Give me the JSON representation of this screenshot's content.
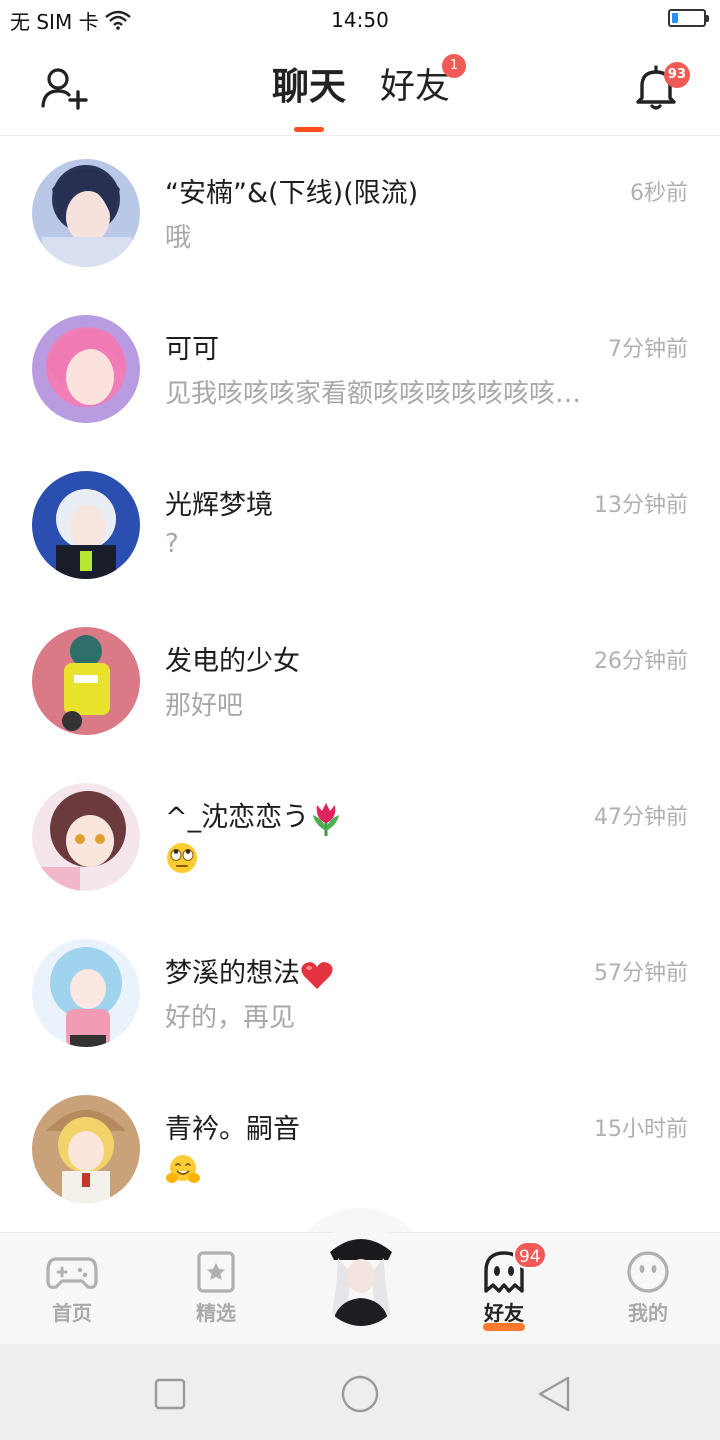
{
  "status_bar": {
    "carrier": "无 SIM 卡",
    "time": "14:50",
    "battery_level": 0.2
  },
  "header": {
    "tabs": [
      {
        "label": "聊天",
        "active": true
      },
      {
        "label": "好友",
        "active": false,
        "badge": "1"
      }
    ],
    "notification_badge": "93",
    "accent_color": "#ff4f1f",
    "badge_color": "#f25a55"
  },
  "chats": [
    {
      "name": "“安楠”&(下线)(限流)",
      "message": "哦",
      "time": "6秒前"
    },
    {
      "name": "可可",
      "message": "见我咳咳咳家看额咳咳咳咳咳咳咳咳咳咳咳",
      "time": "7分钟前"
    },
    {
      "name": "光辉梦境",
      "message": "?",
      "time": "13分钟前"
    },
    {
      "name": "发电的少女",
      "message": "那好吧",
      "time": "26分钟前"
    },
    {
      "name": "^_沈恋恋う",
      "name_emoji": "tulip-emoji",
      "message_emoji": "eye-roll-emoji",
      "message": "",
      "time": "47分钟前"
    },
    {
      "name": "梦溪的想法",
      "name_emoji": "heart-emoji",
      "message": "好的，再见",
      "time": "57分钟前"
    },
    {
      "name": "青衿。嗣音",
      "message_emoji": "hug-emoji",
      "message": "",
      "time": "15小时前"
    }
  ],
  "bottom_nav": {
    "items": [
      {
        "label": "首页",
        "icon": "gamepad-icon",
        "active": false
      },
      {
        "label": "精选",
        "icon": "star-bookmark-icon",
        "active": false
      },
      {
        "label": "好友",
        "icon": "ghost-icon",
        "active": true,
        "badge": "94"
      },
      {
        "label": "我的",
        "icon": "smiley-face-icon",
        "active": false
      }
    ]
  },
  "system_nav": {
    "buttons": [
      "recent-apps-icon",
      "home-icon",
      "back-icon"
    ]
  }
}
